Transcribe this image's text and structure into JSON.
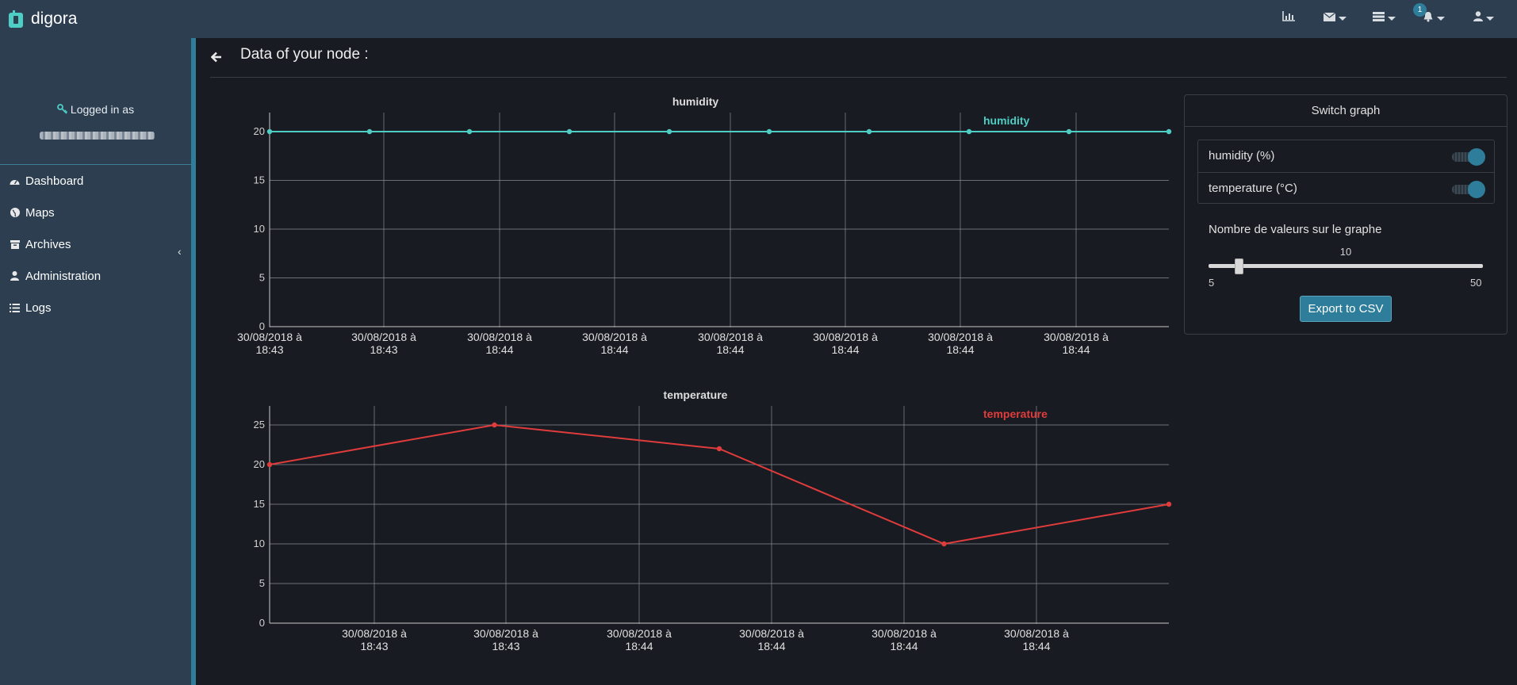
{
  "brand": {
    "name": "digora"
  },
  "navbar": {
    "icons": [
      "chart-icon",
      "envelope-icon",
      "tasks-icon",
      "bell-icon",
      "user-icon"
    ],
    "notifications_count": "1"
  },
  "sidebar": {
    "logged_in_label": "Logged in as",
    "items": [
      {
        "label": "Dashboard",
        "icon": "dashboard-icon"
      },
      {
        "label": "Maps",
        "icon": "globe-icon"
      },
      {
        "label": "Archives",
        "icon": "archive-icon"
      },
      {
        "label": "Administration",
        "icon": "user-icon"
      },
      {
        "label": "Logs",
        "icon": "list-icon"
      }
    ]
  },
  "header": {
    "title": "Data of your node :"
  },
  "panel": {
    "heading": "Switch graph",
    "switches": [
      {
        "label": "humidity (%)",
        "on": true
      },
      {
        "label": "temperature (°C)",
        "on": true
      }
    ],
    "slider": {
      "label": "Nombre de valeurs sur le graphe",
      "value": 10,
      "min": 5,
      "max": 50
    },
    "export_label": "Export to CSV"
  },
  "colors": {
    "accent": "#2e7d9a",
    "humidity": "#4ecdc4",
    "temperature": "#e03c3c",
    "navbar": "#2c3e50"
  },
  "chart_data": [
    {
      "type": "line",
      "title": "humidity",
      "ylim": [
        0,
        20
      ],
      "yticks": [
        0,
        5,
        10,
        15,
        20
      ],
      "xtick_labels": [
        [
          "30/08/2018 à",
          "18:43"
        ],
        [
          "30/08/2018 à",
          "18:43"
        ],
        [
          "30/08/2018 à",
          "18:44"
        ],
        [
          "30/08/2018 à",
          "18:44"
        ],
        [
          "30/08/2018 à",
          "18:44"
        ],
        [
          "30/08/2018 à",
          "18:44"
        ],
        [
          "30/08/2018 à",
          "18:44"
        ],
        [
          "30/08/2018 à",
          "18:44"
        ]
      ],
      "series": [
        {
          "name": "humidity",
          "color": "#4ecdc4",
          "values": [
            20,
            20,
            20,
            20,
            20,
            20,
            20,
            20,
            20,
            20
          ]
        }
      ],
      "grid": true,
      "legend": "top-right"
    },
    {
      "type": "line",
      "title": "temperature",
      "ylim": [
        0,
        25
      ],
      "yticks": [
        0,
        5,
        10,
        15,
        20,
        25
      ],
      "xtick_labels": [
        [
          "30/08/2018 à",
          "18:43"
        ],
        [
          "30/08/2018 à",
          "18:43"
        ],
        [
          "30/08/2018 à",
          "18:44"
        ],
        [
          "30/08/2018 à",
          "18:44"
        ],
        [
          "30/08/2018 à",
          "18:44"
        ],
        [
          "30/08/2018 à",
          "18:44"
        ]
      ],
      "series": [
        {
          "name": "temperature",
          "color": "#e03c3c",
          "values": [
            20,
            25,
            22,
            10,
            15
          ]
        }
      ],
      "grid": true,
      "legend": "top-right"
    }
  ]
}
